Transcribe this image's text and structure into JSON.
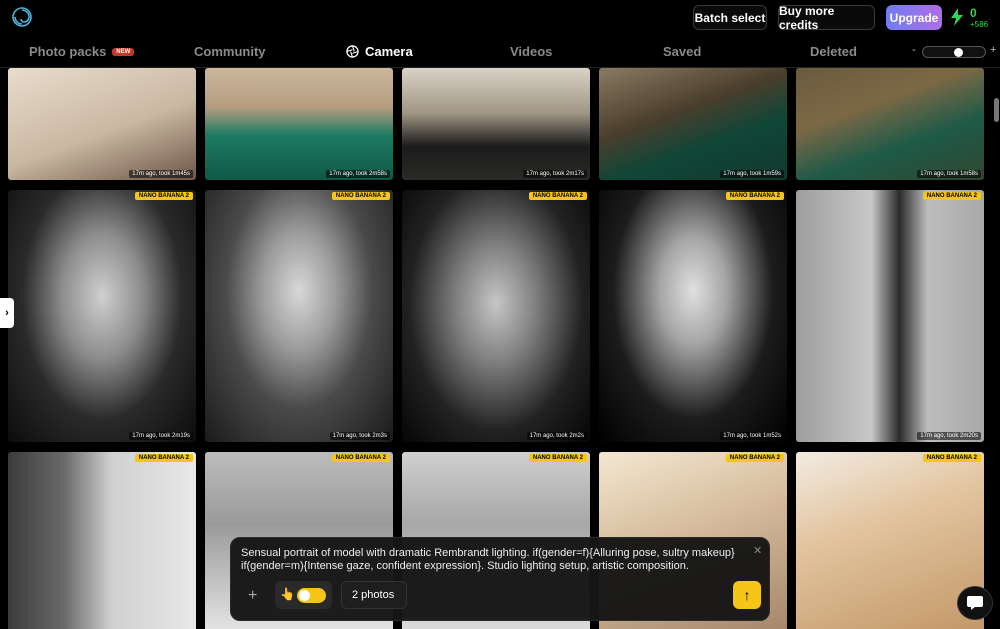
{
  "topbar": {
    "logo_icon": "spiral-logo-icon",
    "batch_label": "Batch select",
    "credits_label": "Buy more credits",
    "upgrade_label": "Upgrade",
    "credit_count": "0",
    "credit_delta": "+586"
  },
  "nav": {
    "tabs": [
      {
        "label": "Photo packs",
        "badge": "NEW"
      },
      {
        "label": "Community"
      },
      {
        "label": "Camera",
        "icon": "aperture-icon"
      },
      {
        "label": "Videos"
      },
      {
        "label": "Saved"
      },
      {
        "label": "Deleted"
      }
    ],
    "zoom_minus": "-",
    "zoom_plus": "+",
    "zoom_level": 0.6
  },
  "grid": {
    "rows": [
      [
        {
          "meta": "17m ago, took 1m45s",
          "badge": ""
        },
        {
          "meta": "17m ago, took 2m58s",
          "badge": ""
        },
        {
          "meta": "17m ago, took 2m17s",
          "badge": ""
        },
        {
          "meta": "17m ago, took 1m59s",
          "badge": ""
        },
        {
          "meta": "17m ago, took 1m58s",
          "badge": ""
        }
      ],
      [
        {
          "meta": "17m ago, took 2m19s",
          "badge": "NANO BANANA 2"
        },
        {
          "meta": "17m ago, took 2m3s",
          "badge": "NANO BANANA 2"
        },
        {
          "meta": "17m ago, took 2m2s",
          "badge": "NANO BANANA 2"
        },
        {
          "meta": "17m ago, took 1m52s",
          "badge": "NANO BANANA 2"
        },
        {
          "meta": "17m ago, took 2m20s",
          "badge": "NANO BANANA 2"
        }
      ],
      [
        {
          "meta": "",
          "badge": "NANO BANANA 2"
        },
        {
          "meta": "",
          "badge": "NANO BANANA 2"
        },
        {
          "meta": "",
          "badge": "NANO BANANA 2"
        },
        {
          "meta": "",
          "badge": "NANO BANANA 2"
        },
        {
          "meta": "",
          "badge": "NANO BANANA 2"
        }
      ]
    ]
  },
  "side_arrow": "›",
  "prompt": {
    "text": "Sensual portrait of model with dramatic Rembrandt lighting. if(gender=f){Alluring pose, sultry makeup} if(gender=m){Intense gaze, confident expression}. Studio lighting setup, artistic composition.",
    "close": "✕",
    "add": "+",
    "hand_icon": "👆",
    "photos_label": "2 photos",
    "send": "↑"
  }
}
